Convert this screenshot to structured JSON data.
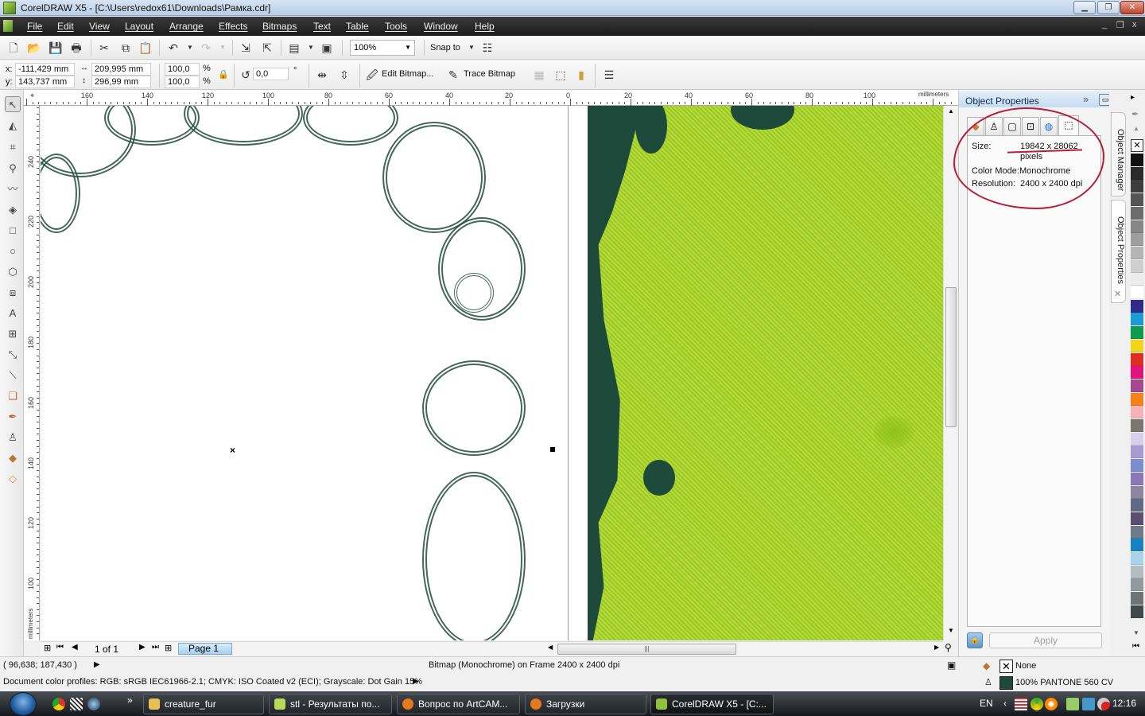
{
  "window": {
    "title": "CorelDRAW X5 - [C:\\Users\\redox61\\Downloads\\Рамка.cdr]",
    "controls": [
      "minimize",
      "restore",
      "close"
    ],
    "doc_controls": [
      "_",
      "❐",
      "x"
    ]
  },
  "menu": [
    "File",
    "Edit",
    "View",
    "Layout",
    "Arrange",
    "Effects",
    "Bitmaps",
    "Text",
    "Table",
    "Tools",
    "Window",
    "Help"
  ],
  "toolbar1": {
    "zoom_level": "100%",
    "snap_to": "Snap to",
    "icons": [
      "new-icon",
      "open-icon",
      "save-icon",
      "print-icon",
      "cut-icon",
      "copy-icon",
      "paste-icon",
      "undo-icon",
      "redo-icon",
      "import-icon",
      "export-icon",
      "application-launcher-icon",
      "welcome-screen-icon",
      "options-icon"
    ]
  },
  "property_bar": {
    "x_label": "x:",
    "x_value": "-111,429 mm",
    "y_label": "y:",
    "y_value": "143,737 mm",
    "width_value": "209,995 mm",
    "height_value": "296,99 mm",
    "scale_x": "100,0",
    "scale_y": "100,0",
    "percent": "%",
    "rotation": "0,0",
    "degree": "°",
    "edit_bitmap": "Edit Bitmap...",
    "trace_bitmap": "Trace Bitmap"
  },
  "rulers": {
    "unit": "millimeters",
    "horizontal_ticks": [
      "160",
      "140",
      "120",
      "100",
      "80",
      "60",
      "40",
      "20",
      "0",
      "20",
      "40",
      "60",
      "80",
      "100"
    ],
    "vertical_ticks": [
      "240",
      "220",
      "200",
      "180",
      "160",
      "140",
      "120",
      "100"
    ]
  },
  "toolbox": [
    "pick-tool",
    "shape-tool",
    "crop-tool",
    "zoom-tool",
    "freehand-tool",
    "smart-fill-tool",
    "rectangle-tool",
    "ellipse-tool",
    "polygon-tool",
    "basic-shapes-tool",
    "text-tool",
    "table-tool",
    "dimension-tool",
    "connector-tool",
    "blend-tool",
    "eyedropper-tool",
    "outline-tool",
    "fill-tool",
    "interactive-fill-tool"
  ],
  "page_nav": {
    "page_count": "1 of 1",
    "page_tab": "Page 1"
  },
  "docker": {
    "title": "Object Properties",
    "tabs": [
      "fill",
      "outline",
      "general",
      "bitmap",
      "internet",
      "summary"
    ],
    "size_label": "Size:",
    "size_value": "19842 x 28062",
    "size_unit": "pixels",
    "color_mode_label": "Color Mode:",
    "color_mode_value": "Monochrome",
    "resolution_label": "Resolution:",
    "resolution_value": "2400 x 2400 dpi",
    "apply": "Apply",
    "side_tabs": [
      "Object Manager",
      "Object Properties"
    ]
  },
  "palette": [
    "#111111",
    "#2a2a2a",
    "#3e3e3e",
    "#555555",
    "#6c6c6c",
    "#878787",
    "#9e9e9e",
    "#b5b5b5",
    "#cfcfcf",
    "#ececec",
    "#ffffff",
    "#2e2a8c",
    "#1c9ad6",
    "#0f9b4c",
    "#f2d41a",
    "#e12c26",
    "#e2127d",
    "#a54891",
    "#f28219",
    "#f6b2b8",
    "#7b7670",
    "#d6d0ea",
    "#a79bd3",
    "#7a8dcf",
    "#8a78b8",
    "#8c86a0",
    "#5f6a86",
    "#5a4f70",
    "#6e7a88",
    "#1583c2",
    "#a8d3ea",
    "#b4bcc2",
    "#939a9d",
    "#6d7376",
    "#404a4c"
  ],
  "status": {
    "cursor": "( 96,638; 187,430 )",
    "object_info": "Bitmap (Monochrome) on Frame 2400 x 2400 dpi",
    "color_profiles": "Document color profiles: RGB: sRGB IEC61966-2.1; CMYK: ISO Coated v2 (ECI); Grayscale: Dot Gain 15%",
    "fill": "None",
    "outline": "100% PANTONE 560 CV",
    "outline_color": "#1e4a3c"
  },
  "taskbar": {
    "tasks": [
      "creature_fur",
      "stl - Результаты по...",
      "Вопрос по ArtCAM...",
      "Загрузки",
      "CorelDRAW X5 - [C:..."
    ],
    "language": "EN",
    "time": "12:16"
  }
}
